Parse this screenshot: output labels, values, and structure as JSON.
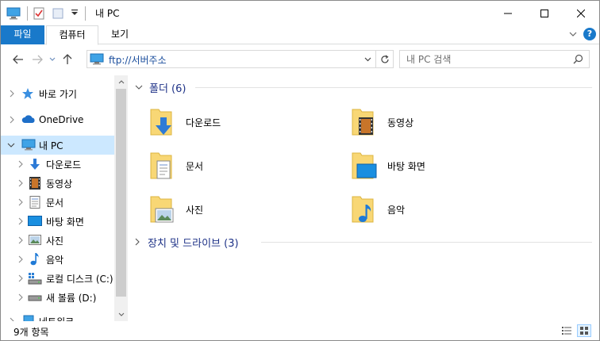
{
  "window": {
    "title": "내 PC"
  },
  "ribbon": {
    "tabs": [
      {
        "label": "파일"
      },
      {
        "label": "컴퓨터"
      },
      {
        "label": "보기"
      }
    ],
    "help_label": "?"
  },
  "nav": {
    "address": "ftp://서버주소",
    "search_placeholder": "내 PC 검색"
  },
  "sidebar": {
    "items": [
      {
        "label": "바로 가기"
      },
      {
        "label": "OneDrive"
      },
      {
        "label": "내 PC"
      },
      {
        "label": "다운로드"
      },
      {
        "label": "동영상"
      },
      {
        "label": "문서"
      },
      {
        "label": "바탕 화면"
      },
      {
        "label": "사진"
      },
      {
        "label": "음악"
      },
      {
        "label": "로컬 디스크 (C:)"
      },
      {
        "label": "새 볼륨 (D:)"
      },
      {
        "label": "네트워크"
      }
    ]
  },
  "content": {
    "folders_header": "폴더 (6)",
    "devices_header": "장치 및 드라이브 (3)",
    "folders": [
      {
        "label": "다운로드"
      },
      {
        "label": "동영상"
      },
      {
        "label": "문서"
      },
      {
        "label": "바탕 화면"
      },
      {
        "label": "사진"
      },
      {
        "label": "음악"
      }
    ]
  },
  "status": {
    "item_count": "9개 항목"
  },
  "colors": {
    "accent": "#1979ca",
    "selection": "#cce8ff",
    "group_title": "#1e3287",
    "folder": "#f8d775"
  }
}
